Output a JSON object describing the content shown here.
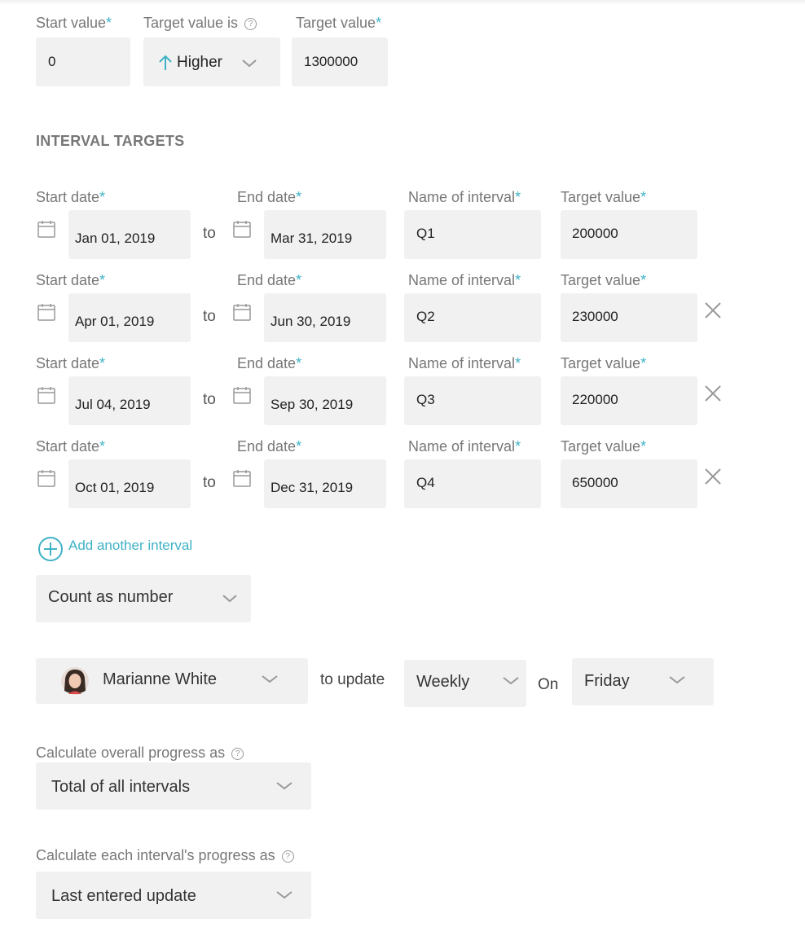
{
  "goal": {
    "start_label": "Start value",
    "start_value": "0",
    "direction_label": "Target value is",
    "direction_value": "Higher",
    "target_label": "Target value",
    "target_value": "1300000"
  },
  "section_title": "INTERVAL TARGETS",
  "interval_labels": {
    "start": "Start date",
    "end": "End date",
    "name": "Name of interval",
    "target": "Target value",
    "to": "to",
    "required_mark": "*"
  },
  "intervals": [
    {
      "start": "Jan 01, 2019",
      "end": "Mar 31, 2019",
      "name": "Q1",
      "target": "200000"
    },
    {
      "start": "Apr 01, 2019",
      "end": "Jun 30, 2019",
      "name": "Q2",
      "target": "230000"
    },
    {
      "start": "Jul 04, 2019",
      "end": "Sep 30, 2019",
      "name": "Q3",
      "target": "220000"
    },
    {
      "start": "Oct 01, 2019",
      "end": "Dec 31, 2019",
      "name": "Q4",
      "target": "650000"
    }
  ],
  "add_interval_label": "Add another interval",
  "count_as": "Count as number",
  "updater": {
    "name": "Marianne White",
    "to_update": "to update",
    "frequency": "Weekly",
    "on_label": "On",
    "day": "Friday"
  },
  "overall_progress": {
    "label": "Calculate overall progress as",
    "value": "Total of all intervals"
  },
  "interval_progress": {
    "label": "Calculate each interval's progress as",
    "value": "Last entered update"
  },
  "colors": {
    "accent": "#3fb2c6",
    "field_bg": "#f1f1f1",
    "label": "#777777"
  },
  "icons": [
    "calendar-icon",
    "chevron-down-icon",
    "close-icon",
    "plus-circle-icon",
    "help-icon",
    "arrow-up-icon"
  ]
}
